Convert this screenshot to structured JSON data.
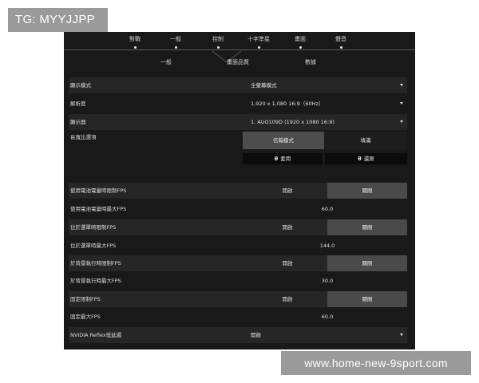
{
  "watermark": {
    "top": "TG: MYYJJPP",
    "bottom": "www.home-new-9sport.com"
  },
  "tabs": [
    {
      "label": "對戰"
    },
    {
      "label": "一般"
    },
    {
      "label": "控制"
    },
    {
      "label": "十字準星"
    },
    {
      "label": "畫面"
    },
    {
      "label": "聲音"
    }
  ],
  "subtabs": [
    {
      "label": "一般"
    },
    {
      "label": "畫面品質"
    },
    {
      "label": "數據"
    }
  ],
  "settings": {
    "display_mode": {
      "label": "顯示模式",
      "value": "全螢幕模式"
    },
    "resolution": {
      "label": "解析度",
      "value": "1,920 x 1,080 16:9（60Hz）"
    },
    "monitor": {
      "label": "顯示器",
      "value": "1. AUO109D (1920 x 1080 16:9)"
    },
    "aspect": {
      "label": "長寬比選項",
      "option_left": "信箱模式",
      "option_right": "填滿"
    },
    "actions": {
      "apply_key": "θ",
      "apply_label": "套用",
      "revert_key": "θ",
      "revert_label": "還原"
    },
    "battery_limit": {
      "label": "使用電池電量時限制FPS",
      "on": "開啟",
      "off": "關閉"
    },
    "battery_max": {
      "label": "使用電池電量時最大FPS",
      "value": "60.0"
    },
    "menu_limit": {
      "label": "位於選單時限制FPS",
      "on": "開啟",
      "off": "關閉"
    },
    "menu_max": {
      "label": "位於選單時最大FPS",
      "value": "144.0"
    },
    "bg_limit": {
      "label": "於背景執行時限制FPS",
      "on": "開啟",
      "off": "關閉"
    },
    "bg_max": {
      "label": "於背景執行時最大FPS",
      "value": "30.0"
    },
    "fixed_limit": {
      "label": "固定限制FPS",
      "on": "開啟",
      "off": "關閉"
    },
    "fixed_max": {
      "label": "固定最大FPS",
      "value": "60.0"
    },
    "reflex": {
      "label": "NVIDIA Reflex低延遲",
      "value": "開啟"
    }
  },
  "colors": {
    "panel_bg": "#191919",
    "row_shade": "#262626",
    "selected": "#4a4a4a",
    "watermark_bg": "#9a9a9a"
  }
}
